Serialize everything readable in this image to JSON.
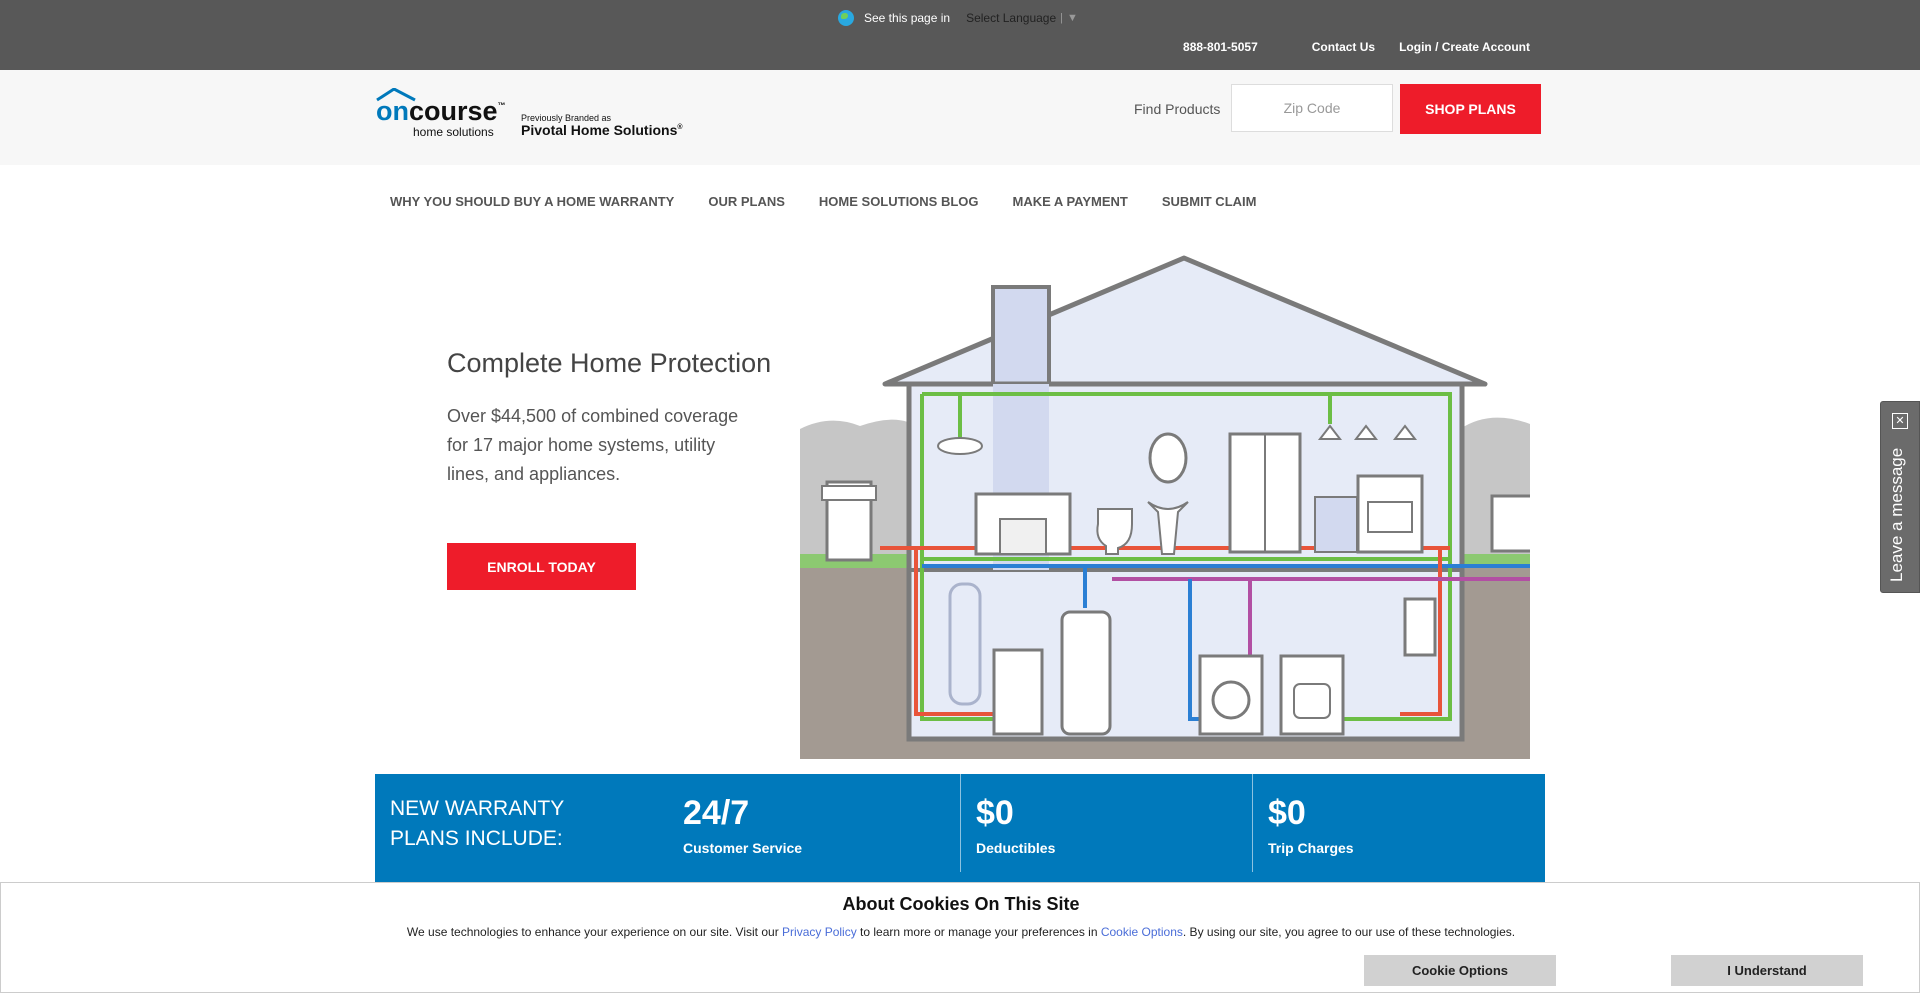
{
  "topbar": {
    "lang_prefix": "See this page in",
    "lang_select": "Select Language",
    "lang_divider": "|",
    "lang_arrow": "▼",
    "phone": "888-801-5057",
    "contact": "Contact Us",
    "login": "Login / Create Account"
  },
  "header": {
    "logo_brand_on": "on",
    "logo_brand_course": "course",
    "logo_sub": "home solutions",
    "logo_trademark": "™",
    "logo_prev": "Previously Branded as",
    "logo_prev_brand": "Pivotal Home Solutions",
    "logo_prev_trademark": "®",
    "find_label": "Find Products",
    "zip_placeholder": "Zip Code",
    "shop_label": "SHOP PLANS"
  },
  "nav": {
    "items": [
      {
        "label": "WHY YOU SHOULD BUY A HOME WARRANTY"
      },
      {
        "label": "OUR PLANS"
      },
      {
        "label": "HOME SOLUTIONS BLOG"
      },
      {
        "label": "MAKE A PAYMENT"
      },
      {
        "label": "SUBMIT CLAIM"
      }
    ]
  },
  "hero": {
    "title": "Complete Home Protection",
    "text": "Over $44,500 of combined coverage for 17 major home systems, utility lines, and appliances.",
    "cta": "ENROLL TODAY"
  },
  "band": {
    "title": "NEW WARRANTY PLANS INCLUDE:",
    "stats": [
      {
        "value": "24/7",
        "label": "Customer Service"
      },
      {
        "value": "$0",
        "label": "Deductibles"
      },
      {
        "value": "$0",
        "label": "Trip Charges"
      }
    ]
  },
  "feedback": {
    "label": "Leave a message",
    "close": "✕"
  },
  "cookie": {
    "title": "About Cookies On This Site",
    "text_1": "We use technologies to enhance your experience on our site. Visit our ",
    "privacy_link": "Privacy Policy",
    "text_2": " to learn more or manage your preferences in ",
    "options_link": "Cookie Options",
    "text_3": ". By using our site, you agree to our use of these technologies.",
    "options_button": "Cookie Options",
    "accept_button": "I Understand"
  },
  "colors": {
    "accent_red": "#ee1c2a",
    "band_blue": "#0079bb",
    "topbar_gray": "#585858"
  }
}
